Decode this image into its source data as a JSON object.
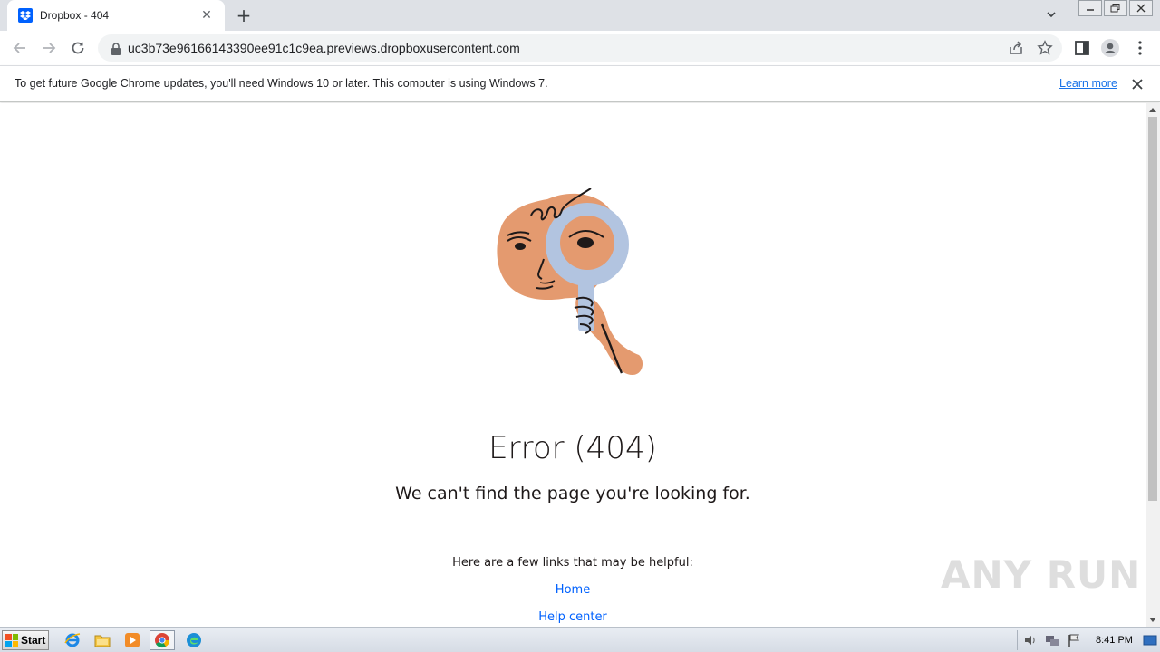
{
  "tab": {
    "title": "Dropbox - 404",
    "close_symbol": "✕",
    "new_tab_symbol": "+"
  },
  "address_bar": {
    "url": "uc3b73e96166143390ee91c1c9ea.previews.dropboxusercontent.com"
  },
  "infobar": {
    "message": "To get future Google Chrome updates, you'll need Windows 10 or later. This computer is using Windows 7.",
    "learn_more": "Learn more"
  },
  "page": {
    "error_title": "Error (404)",
    "error_subtitle": "We can't find the page you're looking for.",
    "links_intro": "Here are a few links that may be helpful:",
    "links": [
      "Home",
      "Help center"
    ]
  },
  "watermark": "ANY RUN",
  "taskbar": {
    "start_label": "Start",
    "clock": "8:41 PM"
  },
  "colors": {
    "dropbox_blue": "#0061fe",
    "illustration_skin": "#e49a6f",
    "illustration_glass": "#b2c4e0",
    "link_blue": "#1a73e8"
  },
  "icons": {
    "tab_favicon": "dropbox-icon",
    "back": "back-arrow-icon",
    "forward": "forward-arrow-icon",
    "reload": "reload-icon",
    "lock": "lock-icon",
    "share": "share-icon",
    "star": "bookmark-star-icon",
    "side_panel": "side-panel-icon",
    "profile": "profile-icon",
    "menu": "kebab-menu-icon"
  }
}
